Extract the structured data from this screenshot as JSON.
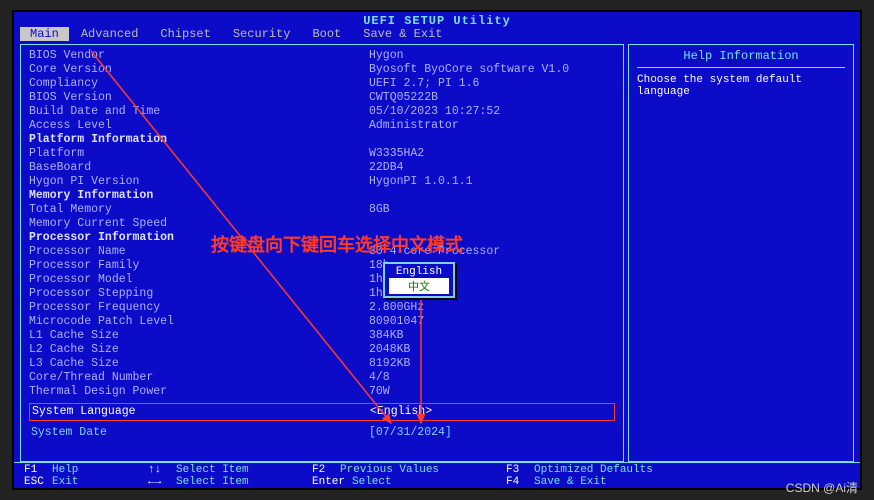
{
  "title": "UEFI SETUP Utility",
  "menu": [
    "Main",
    "Advanced",
    "Chipset",
    "Security",
    "Boot",
    "Save & Exit"
  ],
  "active_menu": 0,
  "help": {
    "title": "Help Information",
    "text": "Choose the system default language"
  },
  "rows": [
    {
      "label": "BIOS Vendor",
      "value": "Hygon"
    },
    {
      "label": "Core Version",
      "value": "Byosoft ByoCore software V1.0"
    },
    {
      "label": "Compliancy",
      "value": "UEFI 2.7; PI 1.6"
    },
    {
      "label": "BIOS Version",
      "value": "CWTQ05222B"
    },
    {
      "label": "Build Date and Time",
      "value": "05/10/2023 10:27:52"
    },
    {
      "label": "Access Level",
      "value": "Administrator"
    },
    {
      "label": "",
      "value": ""
    },
    {
      "label": "Platform Information",
      "value": "",
      "header": true
    },
    {
      "label": "Platform",
      "value": "W3335HA2"
    },
    {
      "label": "BaseBoard",
      "value": "22DB4"
    },
    {
      "label": "Hygon PI Version",
      "value": "HygonPI 1.0.1.1"
    },
    {
      "label": "",
      "value": ""
    },
    {
      "label": "Memory Information",
      "value": "",
      "header": true
    },
    {
      "label": "Total Memory",
      "value": "8GB"
    },
    {
      "label": "Memory Current Speed",
      "value": ""
    },
    {
      "label": "",
      "value": ""
    },
    {
      "label": "Processor Information",
      "value": "",
      "header": true
    },
    {
      "label": "Processor Name",
      "value": "         30  4-core Processor"
    },
    {
      "label": "Processor Family",
      "value": "18h"
    },
    {
      "label": "Processor Model",
      "value": "1h"
    },
    {
      "label": "Processor Stepping",
      "value": "1h"
    },
    {
      "label": "Processor Frequency",
      "value": "2.800GHz"
    },
    {
      "label": "Microcode Patch Level",
      "value": "80901047"
    },
    {
      "label": "L1 Cache Size",
      "value": "384KB"
    },
    {
      "label": "L2 Cache Size",
      "value": "2048KB"
    },
    {
      "label": "L3 Cache Size",
      "value": "8192KB"
    },
    {
      "label": "Core/Thread Number",
      "value": "4/8"
    },
    {
      "label": "Thermal Design Power",
      "value": "70W"
    }
  ],
  "selected": {
    "label": "System Language",
    "value": "<English>"
  },
  "date": {
    "label": "System Date",
    "value": "[07/31/2024]"
  },
  "popup": {
    "options": [
      "English",
      "中文"
    ],
    "selected": 1
  },
  "annotation": "按键盘向下键回车选择中文模式",
  "footer": {
    "f1": {
      "key": "F1",
      "desc": "Help"
    },
    "esc": {
      "key": "ESC",
      "desc": "Exit"
    },
    "updown": {
      "key": "↑↓",
      "desc": "Select Item"
    },
    "leftright": {
      "key": "←→",
      "desc": "Select Item"
    },
    "f2": {
      "key": "F2",
      "desc": "Previous Values"
    },
    "enter": {
      "key": "Enter",
      "desc": "Select"
    },
    "f3": {
      "key": "F3",
      "desc": "Optimized Defaults"
    },
    "f4": {
      "key": "F4",
      "desc": "Save & Exit"
    }
  },
  "watermark": "CSDN @Ai清"
}
